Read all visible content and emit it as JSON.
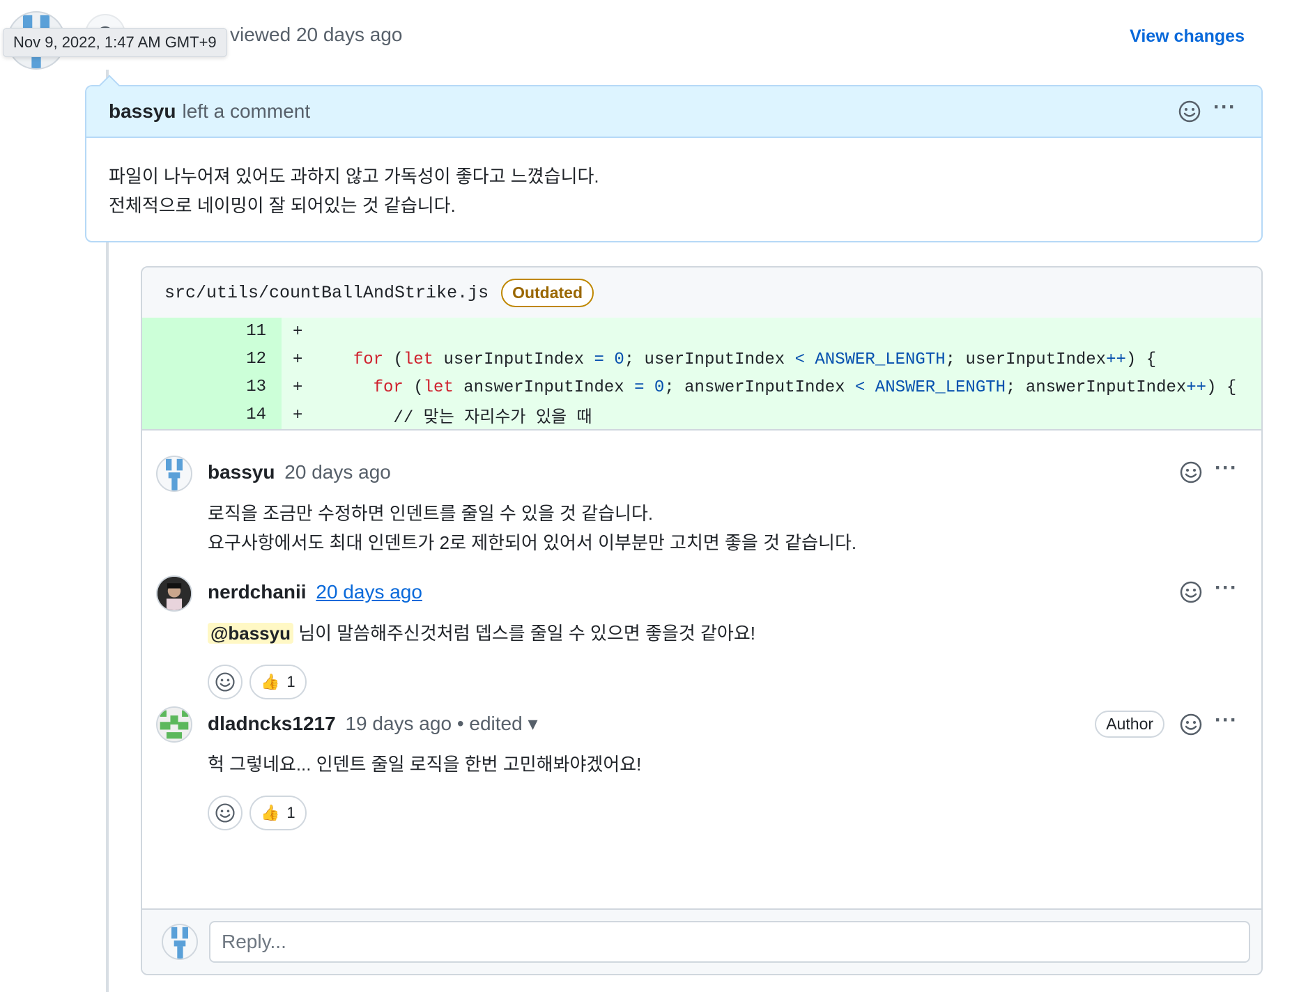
{
  "header": {
    "tooltip_timestamp": "Nov 9, 2022, 1:47 AM GMT+9",
    "reviewed_text": "viewed 20 days ago",
    "view_changes_label": "View changes"
  },
  "review": {
    "author": "bassyu",
    "action": "left a comment",
    "body_lines": [
      "파일이 나누어져 있어도 과하지 않고 가독성이 좋다고 느꼈습니다.",
      "전체적으로 네이밍이 잘 되어있는 것 같습니다."
    ]
  },
  "thread": {
    "file_path": "src/utils/countBallAndStrike.js",
    "outdated_label": "Outdated",
    "diff_lines": [
      {
        "num": "11",
        "sign": "+"
      },
      {
        "num": "12",
        "sign": "+"
      },
      {
        "num": "13",
        "sign": "+"
      },
      {
        "num": "14",
        "sign": "+"
      }
    ],
    "code": {
      "line12": {
        "kw_for": "for",
        "kw_let": "let",
        "var1": "userInputIndex",
        "eq": "=",
        "zero": "0",
        "var2": "userInputIndex",
        "lt": "<",
        "const": "ANSWER_LENGTH",
        "var3": "userInputIndex",
        "inc": "++",
        "brace": ") {"
      },
      "line13": {
        "kw_for": "for",
        "kw_let": "let",
        "var1": "answerInputIndex",
        "eq": "=",
        "zero": "0",
        "var2": "answerInputIndex",
        "lt": "<",
        "const": "ANSWER_LENGTH",
        "var3": "answerInputIndex",
        "inc": "++",
        "brace": ") {"
      },
      "line14": "// 맞는 자리수가 있을 때"
    },
    "comments": [
      {
        "author": "bassyu",
        "time": "20 days ago",
        "body_lines": [
          "로직을 조금만 수정하면 인덴트를 줄일 수 있을 것 같습니다.",
          "요구사항에서도 최대 인덴트가 2로 제한되어 있어서 이부분만 고치면 좋을 것 같습니다."
        ]
      },
      {
        "author": "nerdchanii",
        "time": "20 days ago",
        "mention": "@bassyu",
        "body_rest": " 님이 말씀해주신것처럼 뎁스를 줄일 수 있으면 좋을것 같아요!",
        "reaction_count": "1"
      },
      {
        "author": "dladncks1217",
        "time": "19 days ago",
        "edited_label": "• edited",
        "badge": "Author",
        "body": "헉 그렇네요... 인덴트 줄일 로직을 한번 고민해봐야겠어요!",
        "reaction_count": "1"
      }
    ],
    "reply_placeholder": "Reply..."
  },
  "icons": {
    "smiley": "smiley-icon",
    "kebab": "kebab-horizontal-icon",
    "thumbs_up": "👍",
    "caret_down": "▾"
  },
  "colors": {
    "link": "#0969da",
    "review_header_bg": "#ddf4ff",
    "diff_add_bg": "#e6ffec",
    "diff_add_num_bg": "#ccffd8",
    "outdated": "#9a6700",
    "mention_bg": "#fff8c5"
  },
  "more_glyph": "···"
}
